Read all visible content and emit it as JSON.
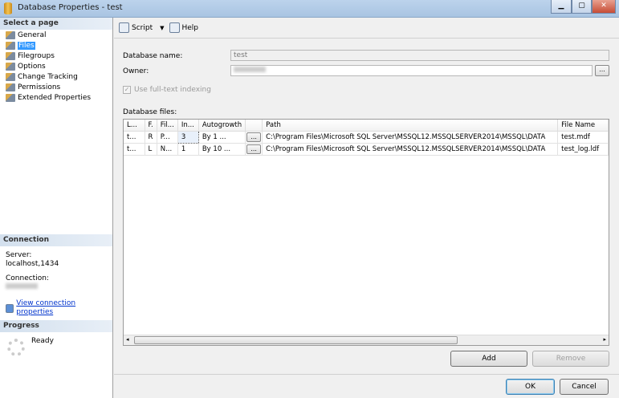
{
  "window": {
    "title": "Database Properties - test"
  },
  "left": {
    "select_header": "Select a page",
    "pages": [
      "General",
      "Files",
      "Filegroups",
      "Options",
      "Change Tracking",
      "Permissions",
      "Extended Properties"
    ],
    "selected": 1,
    "connection_header": "Connection",
    "server_label": "Server:",
    "server_value": "localhost,1434",
    "connection_label": "Connection:",
    "view_link": "View connection properties",
    "progress_header": "Progress",
    "progress_status": "Ready"
  },
  "toolbar": {
    "script": "Script",
    "help": "Help"
  },
  "form": {
    "dbname_label": "Database name:",
    "dbname_value": "test",
    "owner_label": "Owner:",
    "browse": "...",
    "fulltext_label": "Use full-text indexing",
    "fulltext_checked": true,
    "files_label": "Database files:"
  },
  "grid": {
    "columns": [
      "L...",
      "F.",
      "Fil...",
      "In...",
      "Autogrowth",
      "",
      "Path",
      "File Name"
    ],
    "rows": [
      [
        "t...",
        "R",
        "P...",
        "3",
        "By 1 ...",
        "...",
        "C:\\Program Files\\Microsoft SQL Server\\MSSQL12.MSSQLSERVER2014\\MSSQL\\DATA",
        "test.mdf"
      ],
      [
        "t...",
        "L",
        "N...",
        "1",
        "By 10 ...",
        "...",
        "C:\\Program Files\\Microsoft SQL Server\\MSSQL12.MSSQLSERVER2014\\MSSQL\\DATA",
        "test_log.ldf"
      ]
    ]
  },
  "buttons": {
    "add": "Add",
    "remove": "Remove",
    "ok": "OK",
    "cancel": "Cancel"
  }
}
